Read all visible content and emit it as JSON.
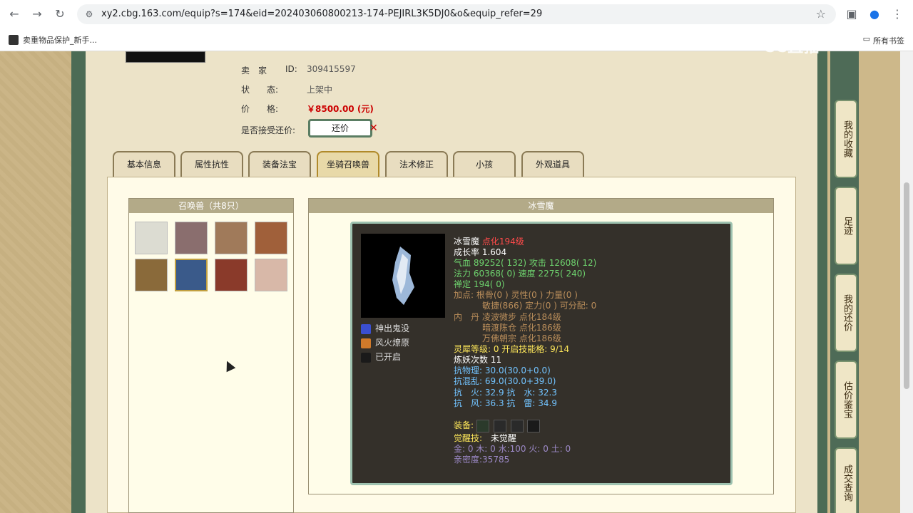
{
  "browser": {
    "url": "xy2.cbg.163.com/equip?s=174&eid=202403060800213-174-PEJIRL3K5DJ0&o&equip_refer=29",
    "bookmark_label": "卖重物品保护_新手...",
    "bookmarks_folder_label": "所有书签"
  },
  "watermark": "CC直播",
  "seller": {
    "seller_label": "卖　家",
    "seller_id_label": "ID:",
    "seller_id": "309415597",
    "status_label": "状　　态:",
    "status_value": "上架中",
    "price_label": "价　　格:",
    "price_value": "￥8500.00 (元)",
    "bargain_label": "是否接受还价:",
    "bargain_button": "还价"
  },
  "tabs": [
    {
      "label": "基本信息"
    },
    {
      "label": "属性抗性"
    },
    {
      "label": "装备法宝"
    },
    {
      "label": "坐骑召唤兽"
    },
    {
      "label": "法术修正"
    },
    {
      "label": "小孩"
    },
    {
      "label": "外观道具"
    }
  ],
  "side_nav": [
    {
      "label": "我的收藏"
    },
    {
      "label": "足迹"
    },
    {
      "label": "我的还价"
    },
    {
      "label": "估价鉴宝"
    },
    {
      "label": "成交查询"
    }
  ],
  "pets_panel": {
    "title": "召唤兽（共8只）",
    "count": 8,
    "selected_index": 5
  },
  "detail": {
    "title": "冰雪魔",
    "name": "冰雪魔",
    "level": "点化194级",
    "growth": "成长率 1.604",
    "hp_line": "气血 89252( 132) 攻击 12608( 12)",
    "mp_line": "法力 60368( 0) 速度 2275( 240)",
    "shending": "禅定 194( 0)",
    "addpoints_1": "加点:  根骨(0 ) 灵性(0 ) 力量(0 )",
    "addpoints_2": "敏捷(866) 定力(0 ) 可分配:  0",
    "dan_label": "内　丹",
    "dan_1": "凌波微步 点化184级",
    "dan_2": "暗渡陈仓 点化186级",
    "dan_3": "万佛朝宗 点化186级",
    "lingxi": "灵犀等级:  0 开启技能格:  9/14",
    "lianyao": "炼妖次数 11",
    "kang_wuli": "抗物理: 30.0(30.0+0.0)",
    "kang_hunluan": "抗混乱: 69.0(30.0+39.0)",
    "kang_huo_shui": "抗　火: 32.9 抗　水: 32.3",
    "kang_feng_lei": "抗　风: 36.3 抗　雷: 34.9",
    "equip_label": "装备:",
    "juexing": "觉醒技:",
    "juexing_value": "未觉醒",
    "wuxing": "金: 0 木: 0 水:100 火: 0 土: 0",
    "qinmi": "亲密度:35785",
    "skills": [
      {
        "label": "神出鬼没",
        "icon": "ghost-skill-icon",
        "color": "#3a4fd0"
      },
      {
        "label": "风火燎原",
        "icon": "fire-skill-icon",
        "color": "#d07a2a"
      },
      {
        "label": "已开启",
        "icon": "locked-slot-icon",
        "color": "#1a1a1a"
      }
    ]
  }
}
